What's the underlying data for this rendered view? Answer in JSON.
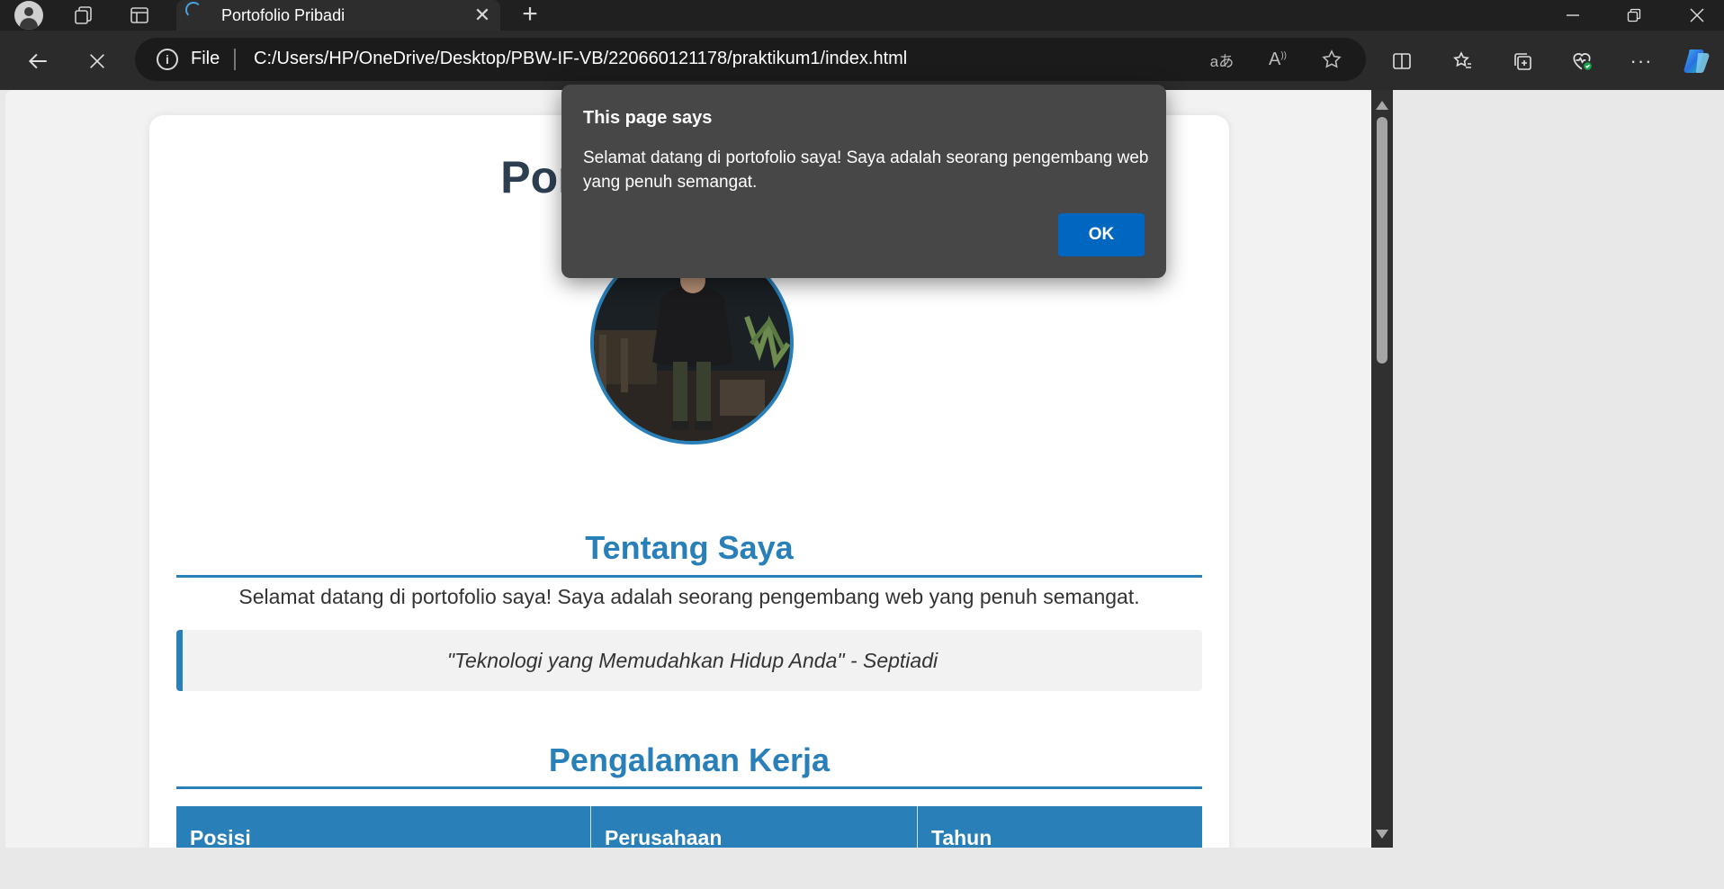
{
  "browser": {
    "tab": {
      "title": "Portofolio Pribadi"
    },
    "address": {
      "scheme_label": "File",
      "url": "C:/Users/HP/OneDrive/Desktop/PBW-IF-VB/220660121178/praktikum1/index.html"
    }
  },
  "page": {
    "title": "Portofolio Pribadi",
    "about": {
      "heading": "Tentang Saya",
      "text": "Selamat datang di portofolio saya! Saya adalah seorang pengembang web yang penuh semangat.",
      "quote": "\"Teknologi yang Memudahkan Hidup Anda\" - Septiadi"
    },
    "experience": {
      "heading": "Pengalaman Kerja",
      "columns": [
        "Posisi",
        "Perusahaan",
        "Tahun"
      ]
    }
  },
  "dialog": {
    "title": "This page says",
    "message": "Selamat datang di portofolio saya! Saya adalah seorang pengembang web yang penuh semangat.",
    "ok_label": "OK"
  },
  "icons": {
    "titlebar": [
      "profile-icon",
      "workspaces-icon",
      "tab-actions-icon",
      "loading-spinner-icon",
      "close-icon",
      "new-tab-icon",
      "minimize-icon",
      "restore-icon",
      "window-close-icon"
    ],
    "toolbar": [
      "back-icon",
      "stop-icon",
      "info-icon",
      "translate-icon",
      "read-aloud-icon",
      "favorite-star-icon",
      "split-screen-icon",
      "favorites-icon",
      "collections-icon",
      "browser-essentials-icon",
      "more-icon",
      "copilot-icon"
    ]
  },
  "colors": {
    "accent": "#2980b9",
    "heading": "#2c3e50",
    "dialog_bg": "#474747",
    "dialog_button": "#0067c0"
  }
}
